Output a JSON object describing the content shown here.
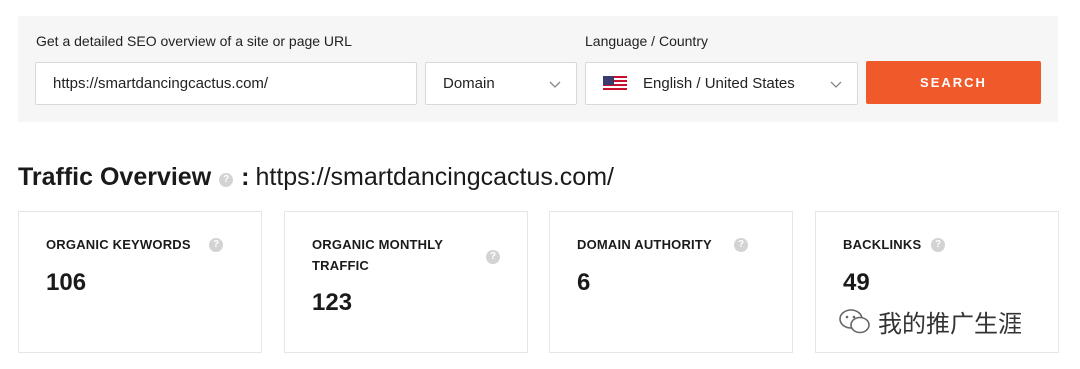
{
  "search": {
    "url_label": "Get a detailed SEO overview of a site or page URL",
    "url_value": "https://smartdancingcactus.com/",
    "mode_value": "Domain",
    "lang_label": "Language / Country",
    "lang_value": "English / United States",
    "button_label": "SEARCH",
    "accent_color": "#f05a2b"
  },
  "overview": {
    "title": "Traffic Overview",
    "url": "https://smartdancingcactus.com/"
  },
  "cards": [
    {
      "title": "ORGANIC KEYWORDS",
      "value": "106"
    },
    {
      "title": "ORGANIC MONTHLY TRAFFIC",
      "title_line1": "ORGANIC MONTHLY",
      "title_line2": "TRAFFIC",
      "value": "123"
    },
    {
      "title": "DOMAIN AUTHORITY",
      "value": "6"
    },
    {
      "title": "BACKLINKS",
      "value": "49"
    }
  ],
  "watermark": {
    "text": "我的推广生涯"
  }
}
